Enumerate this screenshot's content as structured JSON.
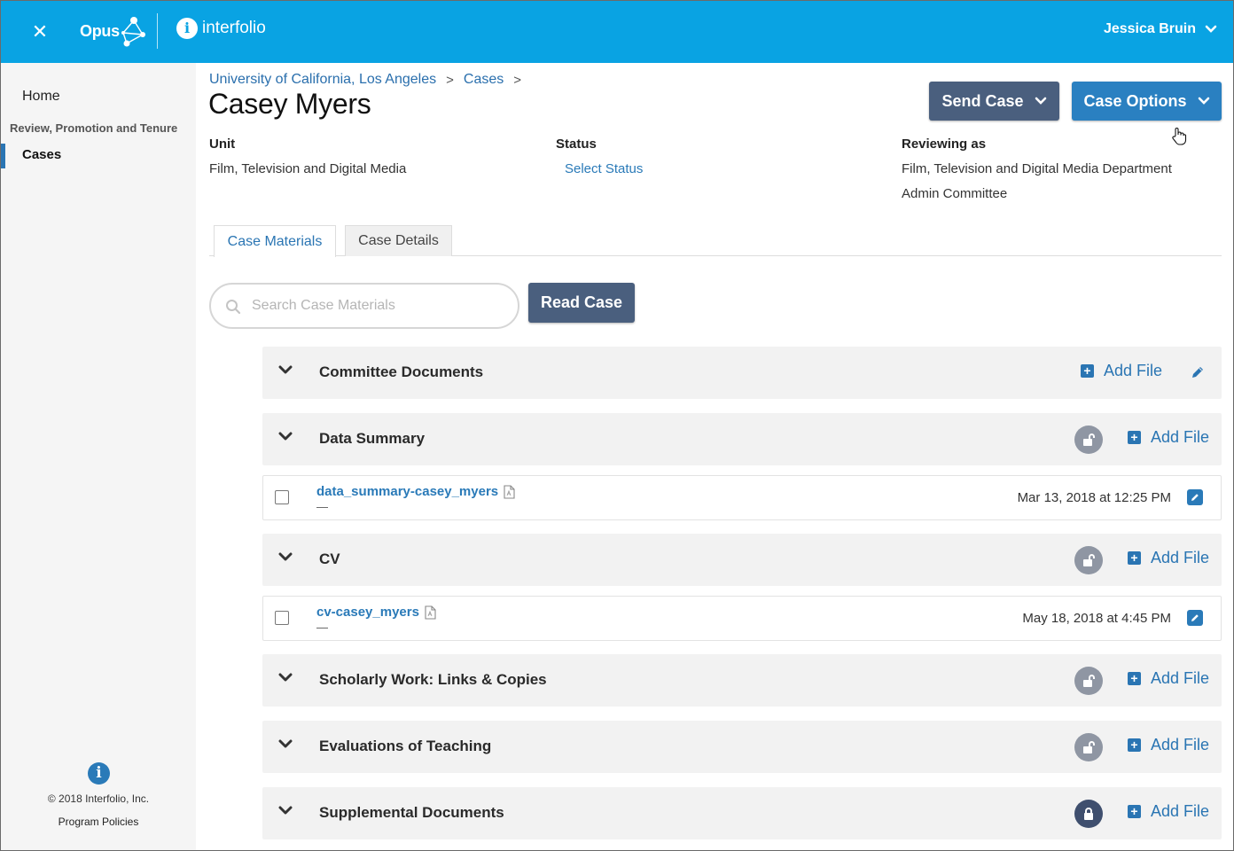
{
  "topbar": {
    "brand_opus": "Opus",
    "brand_interfolio": "interfolio",
    "user_name": "Jessica Bruin"
  },
  "sidebar": {
    "home": "Home",
    "section_label": "Review, Promotion and Tenure",
    "cases": "Cases",
    "copyright": "© 2018 Interfolio, Inc.",
    "policies": "Program Policies"
  },
  "breadcrumb": {
    "items": [
      "University of California, Los Angeles",
      "Cases"
    ],
    "separator": ">"
  },
  "page_title": "Casey Myers",
  "actions": {
    "send_case": "Send Case",
    "case_options": "Case Options",
    "read_case": "Read Case"
  },
  "meta": {
    "unit_label": "Unit",
    "unit_value": "Film, Television and Digital Media",
    "status_label": "Status",
    "status_value": "Select Status",
    "reviewing_label": "Reviewing as",
    "reviewing_value_line1": "Film, Television and Digital Media Department",
    "reviewing_value_line2": "Admin Committee"
  },
  "tabs": {
    "materials": "Case Materials",
    "details": "Case Details",
    "active": "Case Materials"
  },
  "search": {
    "placeholder": "Search Case Materials"
  },
  "sections": [
    {
      "title": "Committee Documents",
      "add_label": "Add File",
      "lock": "none"
    },
    {
      "title": "Data Summary",
      "add_label": "Add File",
      "lock": "unlocked"
    },
    {
      "title": "CV",
      "add_label": "Add File",
      "lock": "unlocked"
    },
    {
      "title": "Scholarly Work: Links & Copies",
      "add_label": "Add File",
      "lock": "unlocked"
    },
    {
      "title": "Evaluations of Teaching",
      "add_label": "Add File",
      "lock": "unlocked"
    },
    {
      "title": "Supplemental Documents",
      "add_label": "Add File",
      "lock": "locked"
    }
  ],
  "files": [
    {
      "name": "data_summary-casey_myers",
      "subtext": "—",
      "date": "Mar 13, 2018 at 12:25 PM"
    },
    {
      "name": "cv-casey_myers",
      "subtext": "—",
      "date": "May 18, 2018 at 4:45 PM"
    }
  ],
  "colors": {
    "topbar": "#09a3e3",
    "link": "#2a75b3",
    "send_button": "#4a5f7e",
    "options_button": "#2a80c1"
  }
}
